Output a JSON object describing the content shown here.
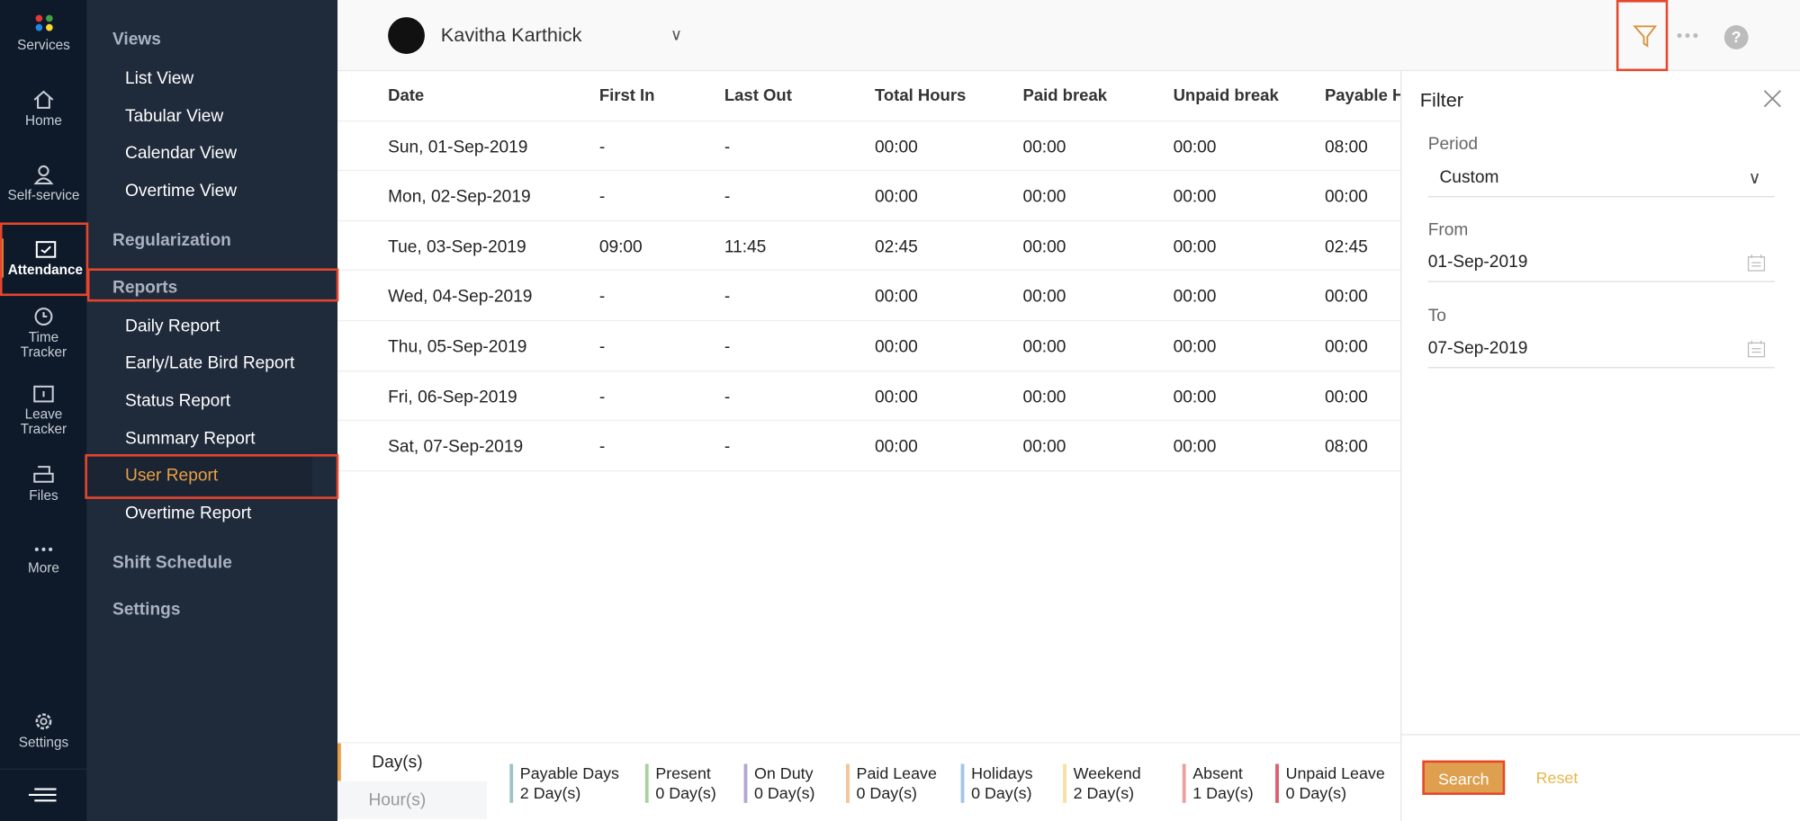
{
  "rail": {
    "items": [
      {
        "label": "Services",
        "icon": "apps-icon"
      },
      {
        "label": "Home",
        "icon": "home-icon"
      },
      {
        "label": "Self-service",
        "icon": "user-icon"
      },
      {
        "label": "Attendance",
        "icon": "calendar-check-icon"
      },
      {
        "label": "Time Tracker",
        "icon": "clock-icon"
      },
      {
        "label": "Leave Tracker",
        "icon": "calendar-icon"
      },
      {
        "label": "Files",
        "icon": "files-icon"
      },
      {
        "label": "More",
        "icon": "more-icon"
      },
      {
        "label": "Settings",
        "icon": "gear-icon"
      }
    ]
  },
  "side": {
    "views": "Views",
    "view_items": [
      "List View",
      "Tabular View",
      "Calendar View",
      "Overtime View"
    ],
    "regularization": "Regularization",
    "reports": "Reports",
    "report_items": [
      "Daily Report",
      "Early/Late Bird Report",
      "Status Report",
      "Summary Report",
      "User Report",
      "Overtime Report"
    ],
    "shift": "Shift Schedule",
    "settings": "Settings"
  },
  "header": {
    "user": "Kavitha Karthick"
  },
  "table": {
    "columns": [
      "Date",
      "First In",
      "Last Out",
      "Total Hours",
      "Paid break",
      "Unpaid break",
      "Payable H"
    ],
    "rows": [
      [
        "Sun, 01-Sep-2019",
        "-",
        "-",
        "00:00",
        "00:00",
        "00:00",
        "08:00"
      ],
      [
        "Mon, 02-Sep-2019",
        "-",
        "-",
        "00:00",
        "00:00",
        "00:00",
        "00:00"
      ],
      [
        "Tue, 03-Sep-2019",
        "09:00",
        "11:45",
        "02:45",
        "00:00",
        "00:00",
        "02:45"
      ],
      [
        "Wed, 04-Sep-2019",
        "-",
        "-",
        "00:00",
        "00:00",
        "00:00",
        "00:00"
      ],
      [
        "Thu, 05-Sep-2019",
        "-",
        "-",
        "00:00",
        "00:00",
        "00:00",
        "00:00"
      ],
      [
        "Fri, 06-Sep-2019",
        "-",
        "-",
        "00:00",
        "00:00",
        "00:00",
        "00:00"
      ],
      [
        "Sat, 07-Sep-2019",
        "-",
        "-",
        "00:00",
        "00:00",
        "00:00",
        "08:00"
      ]
    ]
  },
  "filter": {
    "title": "Filter",
    "period_label": "Period",
    "period": "Custom",
    "from_label": "From",
    "from": "01-Sep-2019",
    "to_label": "To",
    "to": "07-Sep-2019",
    "search": "Search",
    "reset": "Reset"
  },
  "bottom": {
    "tabs": [
      "Day(s)",
      "Hour(s)"
    ],
    "legend": [
      {
        "name": "Payable Days",
        "value": "2 Day(s)",
        "color": "#9cc3c8"
      },
      {
        "name": "Present",
        "value": "0 Day(s)",
        "color": "#a9d0a0"
      },
      {
        "name": "On Duty",
        "value": "0 Day(s)",
        "color": "#b3a6d6"
      },
      {
        "name": "Paid Leave",
        "value": "0 Day(s)",
        "color": "#f4c49a"
      },
      {
        "name": "Holidays",
        "value": "0 Day(s)",
        "color": "#a3c6e6"
      },
      {
        "name": "Weekend",
        "value": "2 Day(s)",
        "color": "#f7e0a0"
      },
      {
        "name": "Absent",
        "value": "1 Day(s)",
        "color": "#e8a0a0"
      },
      {
        "name": "Unpaid Leave",
        "value": "0 Day(s)",
        "color": "#d9606a"
      }
    ]
  }
}
